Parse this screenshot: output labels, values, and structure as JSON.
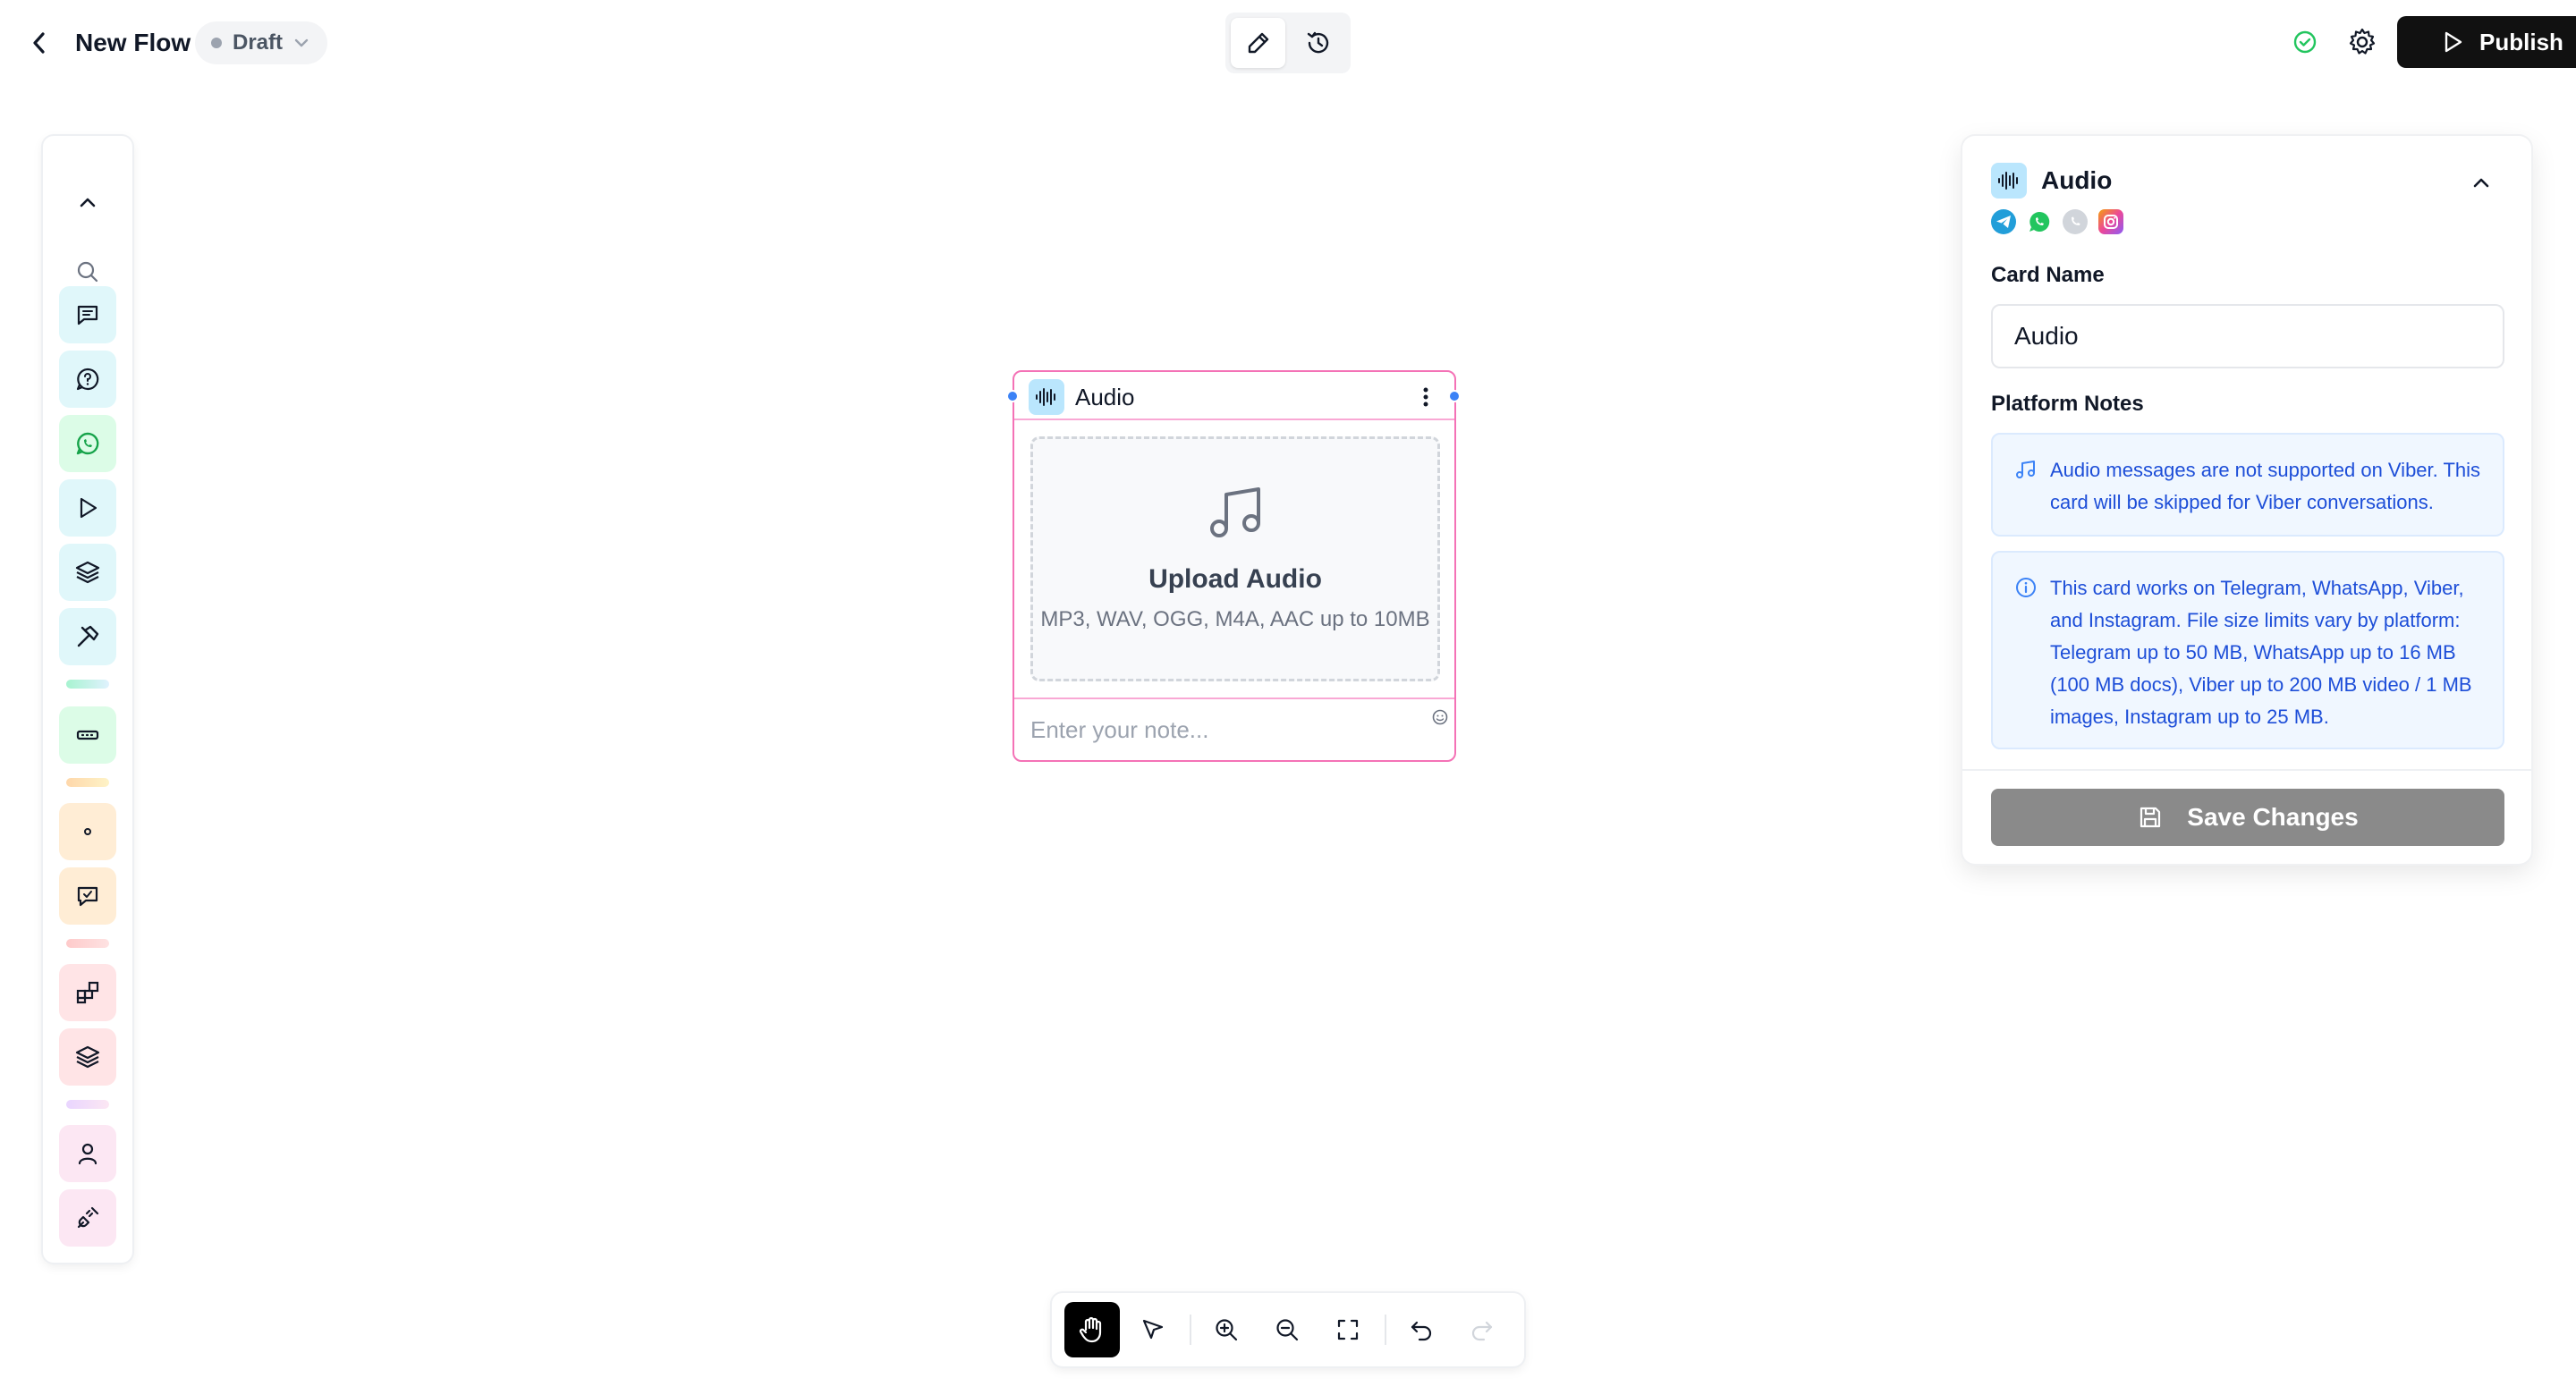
{
  "header": {
    "back_icon": "chevron-left-icon",
    "title": "New Flow",
    "status": "Draft",
    "status_chevron_icon": "chevron-down-icon",
    "mode_edit_icon": "pencil-icon",
    "mode_history_icon": "history-icon",
    "saved_icon": "check-circle-icon",
    "settings_icon": "gear-icon",
    "publish_label": "Publish",
    "publish_icon": "play-icon"
  },
  "left_toolbar": {
    "items": [
      {
        "name": "collapse-toolbar",
        "icon": "chevron-up-icon"
      },
      {
        "name": "search",
        "icon": "search-icon"
      },
      {
        "name": "message",
        "icon": "message-square-icon"
      },
      {
        "name": "question",
        "icon": "message-question-icon"
      },
      {
        "name": "whatsapp",
        "icon": "whatsapp-icon"
      },
      {
        "name": "start",
        "icon": "play-icon"
      },
      {
        "name": "layers",
        "icon": "layers-icon"
      },
      {
        "name": "tools",
        "icon": "hammer-icon"
      },
      {
        "name": "input",
        "icon": "input-field-icon"
      },
      {
        "name": "dot",
        "icon": "dot-icon"
      },
      {
        "name": "reply",
        "icon": "message-reply-icon"
      },
      {
        "name": "blocks",
        "icon": "blocks-icon"
      },
      {
        "name": "stack",
        "icon": "layers-icon"
      },
      {
        "name": "user",
        "icon": "user-icon"
      },
      {
        "name": "integration",
        "icon": "plug-icon"
      }
    ],
    "colors": {
      "blue": "#e0f7fa",
      "green": "#dcfce7",
      "orange": "#ffedd5",
      "red": "#ffe4e6",
      "purple": "#fce7f3"
    }
  },
  "card": {
    "title": "Audio",
    "icon": "audio-wave-icon",
    "menu_icon": "more-vertical-icon",
    "upload_icon": "music-note-icon",
    "upload_title": "Upload Audio",
    "upload_sub": "MP3, WAV, OGG, M4A, AAC up to 10MB",
    "note_placeholder": "Enter your note...",
    "emoji_icon": "smile-icon",
    "accent": "#f472b6"
  },
  "panel": {
    "title": "Audio",
    "icon": "audio-wave-icon",
    "collapse_icon": "chevron-up-icon",
    "platforms": [
      "telegram-icon",
      "whatsapp-icon",
      "viber-icon",
      "instagram-icon"
    ],
    "card_name_label": "Card Name",
    "card_name_value": "Audio",
    "platform_notes_label": "Platform Notes",
    "notes": [
      {
        "icon": "music-note-icon",
        "text": "Audio messages are not supported on Viber. This card will be skipped for Viber conversations."
      },
      {
        "icon": "info-icon",
        "text": "This card works on Telegram, WhatsApp, Viber, and Instagram. File size limits vary by platform: Telegram up to 50 MB, WhatsApp up to 16 MB (100 MB docs), Viber up to 200 MB video / 1 MB images, Instagram up to 25 MB."
      }
    ],
    "save_label": "Save Changes",
    "save_icon": "save-icon"
  },
  "bottom_toolbar": {
    "tools": [
      {
        "name": "pan-tool",
        "icon": "hand-icon",
        "active": true
      },
      {
        "name": "select-tool",
        "icon": "pointer-icon"
      },
      {
        "name": "zoom-in",
        "icon": "zoom-in-icon"
      },
      {
        "name": "zoom-out",
        "icon": "zoom-out-icon"
      },
      {
        "name": "fit-view",
        "icon": "fullscreen-icon"
      },
      {
        "name": "undo",
        "icon": "undo-icon"
      },
      {
        "name": "redo",
        "icon": "redo-icon"
      }
    ]
  }
}
